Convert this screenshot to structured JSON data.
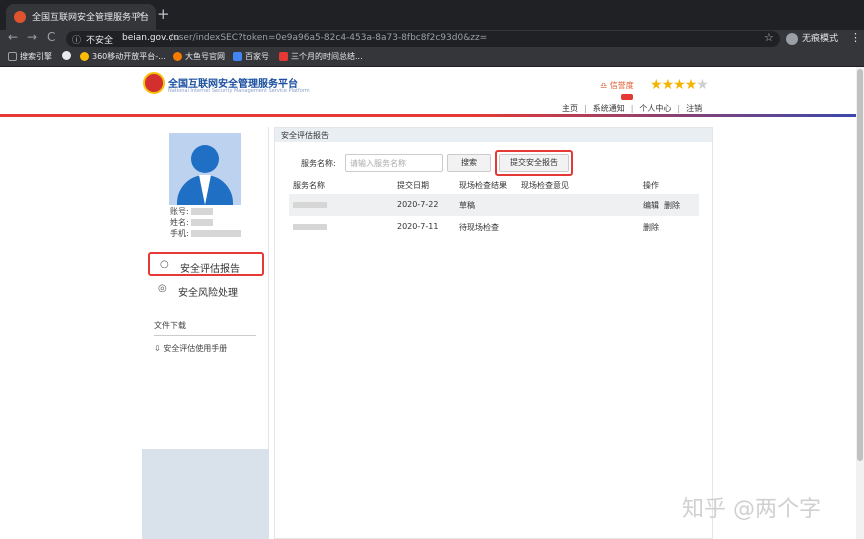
{
  "browser": {
    "tab_title": "全国互联网安全管理服务平台",
    "tab_close": "×",
    "new_tab": "+",
    "nav_back": "←",
    "nav_forward": "→",
    "nav_reload": "C",
    "secure_label": "不安全",
    "url_host": "beian.gov.cn",
    "url_path": "/user/indexSEC?token=0e9a96a5-82c4-453a-8a73-8fbc8f2c93d0&zz=",
    "incognito_label": "无痕模式",
    "bookmarks": [
      {
        "label": "搜索引擎",
        "color": "#9aa0a6"
      },
      {
        "label": "",
        "color": "#e8eaed"
      },
      {
        "label": "360移动开放平台-...",
        "color": "#fbbc05"
      },
      {
        "label": "大鱼号官网",
        "color": "#f57c00"
      },
      {
        "label": "百家号",
        "color": "#4285f4"
      },
      {
        "label": "三个月的时间总结...",
        "color": "#e53935"
      }
    ]
  },
  "site": {
    "title": "全国互联网安全管理服务平台",
    "subtitle": "National Internet Security Management Service Platform",
    "credit_label": "信誉度",
    "rating_stars": 4,
    "rating_max": 5,
    "top_links": [
      "主页",
      "系统通知",
      "个人中心",
      "注销"
    ]
  },
  "profile": {
    "account_label": "账号:",
    "name_label": "姓名:",
    "phone_label": "手机:"
  },
  "sidebar": {
    "items": [
      {
        "label": "安全评估报告",
        "icon": "search-icon",
        "active": true
      },
      {
        "label": "安全风险处理",
        "icon": "shield-icon",
        "active": false
      }
    ],
    "downloads_title": "文件下载",
    "download_item": "安全评估使用手册"
  },
  "main": {
    "panel_title": "安全评估报告",
    "search_label": "服务名称:",
    "search_placeholder": "请输入服务名称",
    "search_button": "搜索",
    "submit_button": "提交安全报告",
    "columns": [
      "服务名称",
      "提交日期",
      "现场检查结果",
      "现场检查意见",
      "操作"
    ],
    "rows": [
      {
        "date": "2020-7-22",
        "result": "草稿",
        "opinion": "",
        "actions": [
          "编辑",
          "删除"
        ]
      },
      {
        "date": "2020-7-11",
        "result": "待现场检查",
        "opinion": "",
        "actions": [
          "删除"
        ]
      }
    ]
  },
  "watermark": "知乎 @两个字",
  "colors": {
    "accent_red": "#e53935",
    "brand_blue": "#1a4fa0",
    "star_gold": "#f5b400"
  }
}
